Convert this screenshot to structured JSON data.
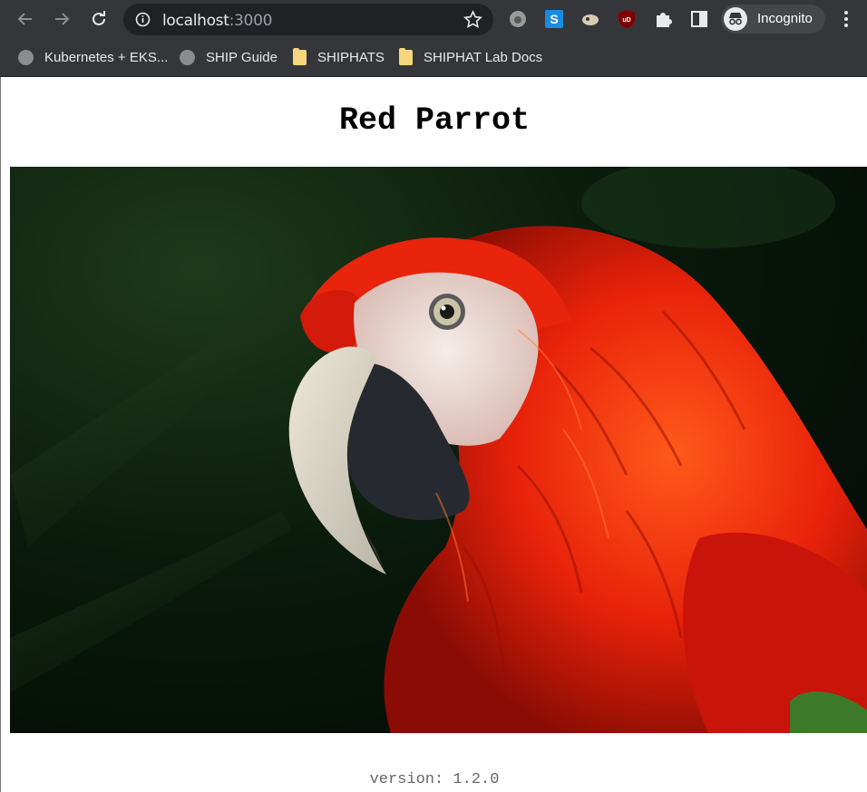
{
  "browser": {
    "url_host": "localhost",
    "url_port": ":3000",
    "profile_label": "Incognito",
    "extensions": [
      "extension-icon-1",
      "s-extension-icon",
      "extension-icon-3",
      "ublock-icon",
      "puzzle-icon",
      "side-panel-icon"
    ]
  },
  "bookmarks": [
    {
      "label": "Kubernetes + EKS...",
      "icon": "globe-icon"
    },
    {
      "label": "SHIP Guide",
      "icon": "globe-icon"
    },
    {
      "label": "SHIPHATS",
      "icon": "folder-icon"
    },
    {
      "label": "SHIPHAT Lab Docs",
      "icon": "folder-icon"
    }
  ],
  "page": {
    "title": "Red Parrot",
    "image_alt_icon": "parrot-photo",
    "version": "version: 1.2.0"
  }
}
